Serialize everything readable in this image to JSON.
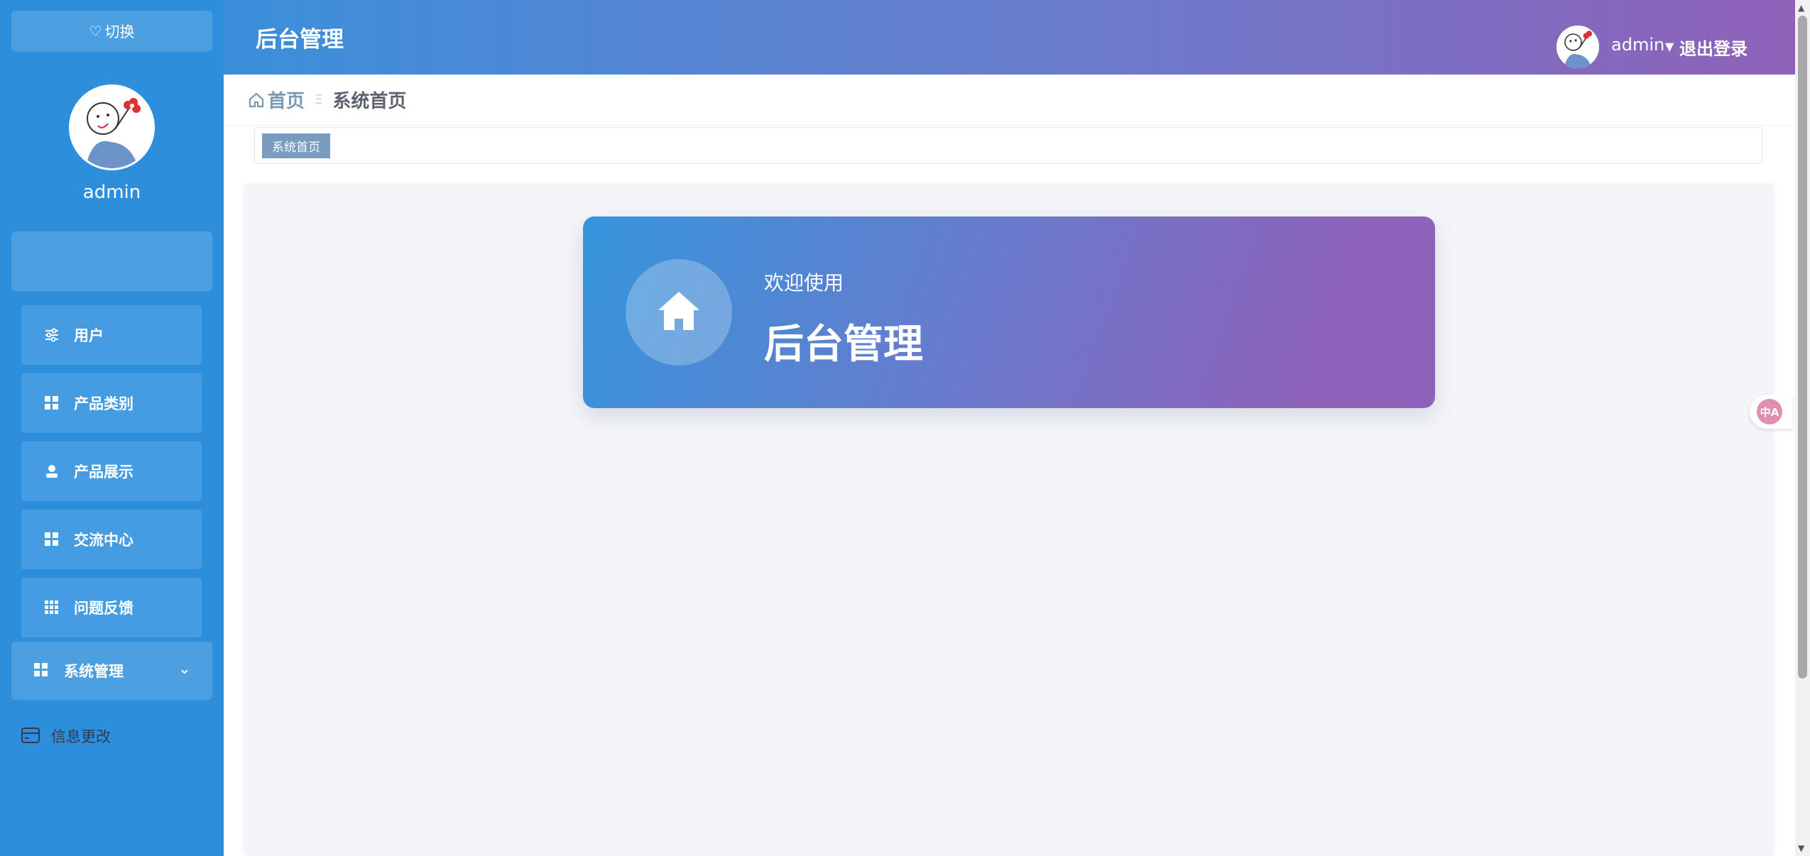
{
  "sidebar": {
    "switch_label": "切换",
    "username": "admin",
    "menu": [
      {
        "label": "用户",
        "icon": "sliders-icon"
      },
      {
        "label": "产品类别",
        "icon": "grid-icon"
      },
      {
        "label": "产品展示",
        "icon": "person-icon"
      },
      {
        "label": "交流中心",
        "icon": "grid-icon"
      },
      {
        "label": "问题反馈",
        "icon": "apps-icon"
      }
    ],
    "system": {
      "label": "系统管理",
      "icon": "grid-icon"
    },
    "info": {
      "label": "信息更改",
      "icon": "card-icon"
    }
  },
  "header": {
    "title": "后台管理",
    "username": "admin",
    "logout_label": "退出登录"
  },
  "breadcrumb": {
    "home": "首页",
    "current": "系统首页"
  },
  "tags": [
    "系统首页"
  ],
  "welcome": {
    "subtitle": "欢迎使用",
    "title": "后台管理"
  },
  "translate": {
    "label": "中A"
  },
  "colors": {
    "sidebar_bg": "#2d8fdc",
    "header_gradient_start": "#3b8fda",
    "header_gradient_end": "#8f61b9",
    "tag_bg": "#7a9cc0",
    "main_bg": "#f4f5f9"
  }
}
